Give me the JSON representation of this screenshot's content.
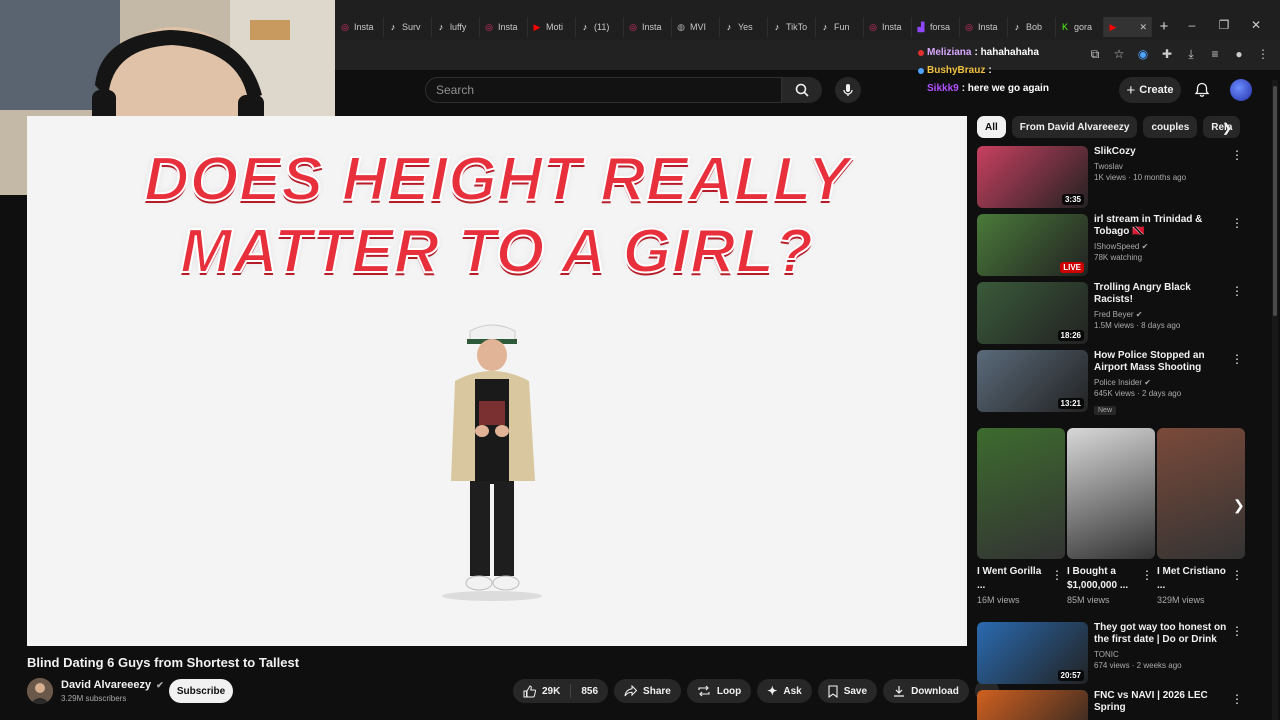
{
  "browser": {
    "tabs": [
      {
        "icon": "instagram-icon",
        "label": "Insta",
        "color": "#e1306c"
      },
      {
        "icon": "tiktok-icon",
        "label": "Surv",
        "color": "#ffffff"
      },
      {
        "icon": "tiktok-icon",
        "label": "luffy",
        "color": "#ffffff"
      },
      {
        "icon": "instagram-icon",
        "label": "Insta",
        "color": "#e1306c"
      },
      {
        "icon": "youtube-icon",
        "label": "Moti",
        "color": "#ff0000"
      },
      {
        "icon": "tiktok-icon",
        "label": "(11)",
        "color": "#ffffff"
      },
      {
        "icon": "instagram-icon",
        "label": "Insta",
        "color": "#e1306c"
      },
      {
        "icon": "globe-icon",
        "label": "MVI",
        "color": "#aaaaaa"
      },
      {
        "icon": "tiktok-icon",
        "label": "Yes",
        "color": "#ffffff"
      },
      {
        "icon": "tiktok-icon",
        "label": "TikTo",
        "color": "#ffffff"
      },
      {
        "icon": "tiktok-icon",
        "label": "Fun",
        "color": "#ffffff"
      },
      {
        "icon": "instagram-icon",
        "label": "Insta",
        "color": "#e1306c"
      },
      {
        "icon": "twitch-icon",
        "label": "forsa",
        "color": "#9146ff"
      },
      {
        "icon": "instagram-icon",
        "label": "Insta",
        "color": "#e1306c"
      },
      {
        "icon": "tiktok-icon",
        "label": "Bob",
        "color": "#ffffff"
      },
      {
        "icon": "kick-icon",
        "label": "gora",
        "color": "#53fc18"
      },
      {
        "icon": "youtube-icon",
        "label": "",
        "color": "#ff0000",
        "active": true
      }
    ],
    "new_tab": "+",
    "window_controls": [
      "–",
      "❐",
      "✕"
    ]
  },
  "header": {
    "search_placeholder": "Search",
    "create_label": "Create"
  },
  "chat": [
    {
      "user": "Meliziana",
      "user_color": "#d9a8ff",
      "text": ": hahahahaha",
      "dot": "#e03030"
    },
    {
      "user": "BushyBrauz",
      "user_color": "#f0c040",
      "text": ":",
      "dot": "#4fa3ff"
    },
    {
      "user": "Sikkk9",
      "user_color": "#b050ff",
      "text": ": here we go again",
      "dot": ""
    }
  ],
  "video": {
    "overlay_line1": "DOES HEIGHT REALLY",
    "overlay_line2": "MATTER TO A GIRL?",
    "title": "Blind Dating 6 Guys from Shortest to Tallest",
    "channel": "David Alvareeezy",
    "subscribers": "3.29M subscribers",
    "subscribe_label": "Subscribe",
    "likes": "29K",
    "comments": "856",
    "share_label": "Share",
    "loop_label": "Loop",
    "ask_label": "Ask",
    "save_label": "Save",
    "download_label": "Download"
  },
  "sidebar": {
    "chips": [
      "All",
      "From David Alvareeezy",
      "couples",
      "Rela"
    ],
    "recommendations": [
      {
        "title": "SlikCozy",
        "channel": "Twoslav",
        "meta": "1K views · 10 months ago",
        "badge": "3:35",
        "thumb": "#c84060",
        "live": false,
        "verified": false,
        "new": false
      },
      {
        "title": "irl stream in Trinidad & Tobago 🇹🇹",
        "channel": "IShowSpeed",
        "meta": "78K watching",
        "badge": "LIVE",
        "thumb": "#4a7a3a",
        "live": true,
        "verified": true,
        "new": false
      },
      {
        "title": "Trolling Angry Black Racists!",
        "channel": "Fred Beyer",
        "meta": "1.5M views · 8 days ago",
        "badge": "18:26",
        "thumb": "#3a5a3a",
        "live": false,
        "verified": true,
        "new": false
      },
      {
        "title": "How Police Stopped an Airport Mass Shooting",
        "channel": "Police Insider",
        "meta": "645K views · 2 days ago",
        "badge": "13:21",
        "thumb": "#5a6a7a",
        "live": false,
        "verified": true,
        "new": true
      }
    ],
    "new_label": "New",
    "shorts": [
      {
        "title": "I Went Gorilla ...",
        "views": "16M views",
        "thumb": "#3d6b2e"
      },
      {
        "title": "I Bought a $1,000,000 ...",
        "views": "85M views",
        "thumb": "#d8d8d8"
      },
      {
        "title": "I Met Cristiano ...",
        "views": "329M views",
        "thumb": "#7a4a3a"
      }
    ],
    "bottom_recs": [
      {
        "title": "They got way too honest on the first date | Do or Drink",
        "channel": "TONIC",
        "meta": "674 views · 2 weeks ago",
        "badge": "20:57",
        "thumb": "#2a6ab0"
      },
      {
        "title": "FNC vs NAVI | 2026 LEC Spring",
        "channel": "",
        "meta": "",
        "badge": "",
        "thumb": "#d06020"
      }
    ]
  }
}
